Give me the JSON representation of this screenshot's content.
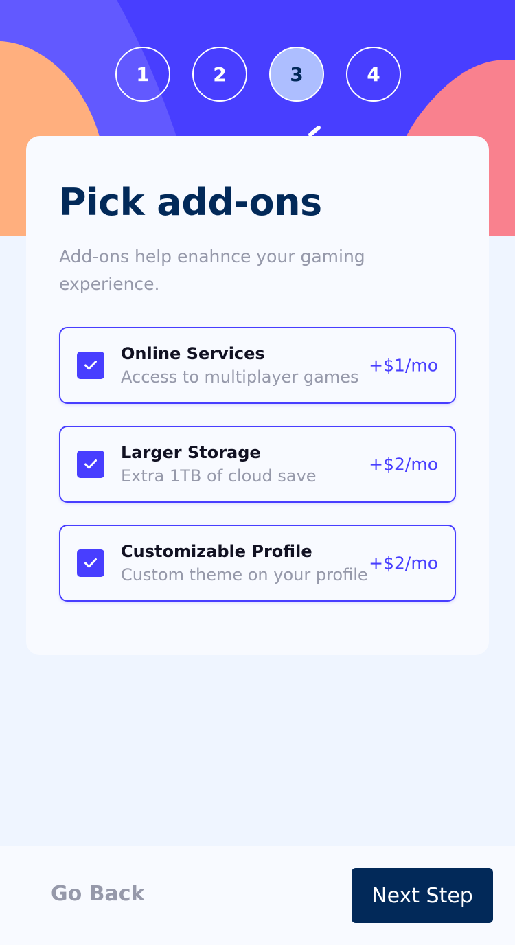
{
  "colors": {
    "primary": "#483eff",
    "denim": "#022959",
    "grey": "#9699aa",
    "background": "#eff5ff",
    "card": "#f8faff",
    "step_active": "#adbeff",
    "blob_orange": "#ffaf7e",
    "blob_pink": "#f9818e"
  },
  "steps": [
    {
      "number": "1",
      "active": false
    },
    {
      "number": "2",
      "active": false
    },
    {
      "number": "3",
      "active": true
    },
    {
      "number": "4",
      "active": false
    }
  ],
  "header": {
    "title": "Pick add-ons",
    "subtitle": "Add-ons help enahnce your gaming experience."
  },
  "addons": [
    {
      "name": "Online Services",
      "description": "Access to multiplayer games",
      "price": "+$1/mo",
      "checked": true,
      "icon": "checkmark-icon"
    },
    {
      "name": "Larger Storage",
      "description": "Extra 1TB of cloud save",
      "price": "+$2/mo",
      "checked": true,
      "icon": "checkmark-icon"
    },
    {
      "name": "Customizable Profile",
      "description": "Custom theme on your profile",
      "price": "+$2/mo",
      "checked": true,
      "icon": "checkmark-icon"
    }
  ],
  "footer": {
    "back_label": "Go Back",
    "next_label": "Next Step"
  }
}
